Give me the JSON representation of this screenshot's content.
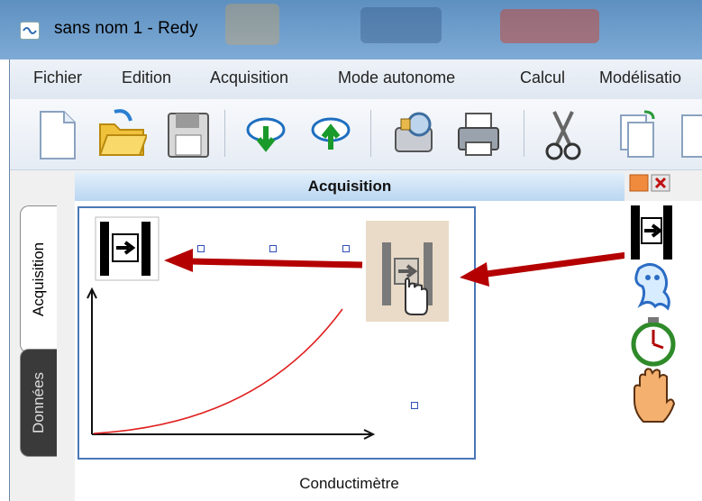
{
  "window": {
    "title": "sans nom 1 - Redy"
  },
  "menu": [
    "Fichier",
    "Edition",
    "Acquisition",
    "Mode autonome",
    "Calcul",
    "Modélisatio"
  ],
  "toolbar": {
    "buttons": [
      "new-document-icon",
      "open-folder-icon",
      "save-floppy-icon",
      "download-cloud-icon",
      "upload-cloud-icon",
      "settings-icon",
      "printer-icon",
      "scissors-icon",
      "copy-icon",
      "paste-icon"
    ]
  },
  "tabs": {
    "acquisition": "Acquisition",
    "donnees": "Données"
  },
  "panel": {
    "title": "Acquisition",
    "sensor_label": "Conductimètre"
  },
  "colors": {
    "curve": "#e02020",
    "arrow": "#b40000",
    "accent": "#4a78b7"
  }
}
